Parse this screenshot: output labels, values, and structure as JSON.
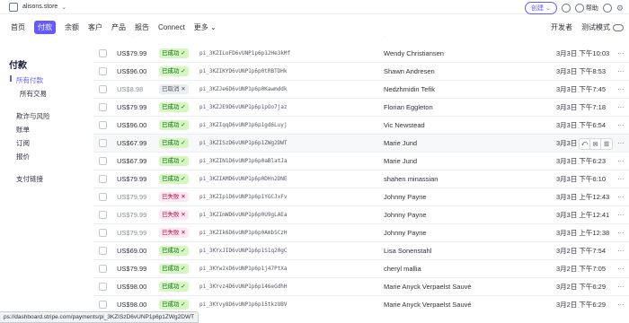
{
  "account": {
    "name": "alisons.store"
  },
  "top_actions": {
    "create_label": "创建",
    "help_label": "帮助"
  },
  "nav": {
    "items": [
      "首页",
      "付款",
      "余额",
      "客户",
      "产品",
      "报告",
      "Connect",
      "更多"
    ],
    "active_index": 1,
    "developers_label": "开发者",
    "test_mode_label": "测试模式"
  },
  "sidebar": {
    "title": "付款",
    "items": [
      "所有付款",
      "所有交易",
      "欺诈与风险",
      "账单",
      "订阅",
      "报价",
      "支付链接"
    ],
    "active_index": 0
  },
  "payments": [
    {
      "amount": "US$79.99",
      "status": "已成功",
      "kind": "ok",
      "id": "pi_3KZILoFD6vUNP1p6p12He3kMf",
      "customer": "Wendy Christiansen",
      "date": "3月3日 下午10:03"
    },
    {
      "amount": "US$96.00",
      "status": "已成功",
      "kind": "ok",
      "id": "pi_3KZIKYD6vUNP1p6p0tRBTDHk",
      "customer": "Shawn Andresen",
      "date": "3月3日 下午8:53"
    },
    {
      "amount": "US$8.98",
      "status": "已取消",
      "kind": "void",
      "id": "pi_3KZJe6D6vUNP1p6p0Kawmddk",
      "customer": "Nedzhmidin Tefik",
      "date": "3月3日 下午7:45"
    },
    {
      "amount": "US$79.99",
      "status": "已成功",
      "kind": "ok",
      "id": "pi_3KZJE9D6vUNP1p6p1pOo7jaz",
      "customer": "Florian Eggleton",
      "date": "3月3日 下午7:18"
    },
    {
      "amount": "US$96.00",
      "status": "已成功",
      "kind": "ok",
      "id": "pi_3KZIqqD6vUNP1p6p1gd6Luyj",
      "customer": "Vic Newstead",
      "date": "3月3日 下午6:54"
    },
    {
      "amount": "US$67.99",
      "status": "已成功",
      "kind": "ok",
      "id": "pi_3KZISzD6vUNP1p6p1ZWg2DWT",
      "customer": "Marie Jund",
      "date": "3月3日 下午"
    },
    {
      "amount": "US$67.99",
      "status": "已成功",
      "kind": "ok",
      "id": "pi_3KZIN1D6vUNP1p6p0aBlatJa",
      "customer": "Marie Jund",
      "date": "3月3日 下午6:23"
    },
    {
      "amount": "US$79.99",
      "status": "已成功",
      "kind": "ok",
      "id": "pi_3KZIAMD6vUNP1p6p0DHn2DNE",
      "customer": "shahen minassian",
      "date": "3月3日 下午6:10"
    },
    {
      "amount": "US$79.99",
      "status": "已失败",
      "kind": "fail",
      "id": "pi_3KZIp1D6vUNP1p6p1YGCJxFv",
      "customer": "Johnny Payne",
      "date": "3月3日 上午12:43"
    },
    {
      "amount": "US$79.99",
      "status": "已失败",
      "kind": "fail",
      "id": "pi_3KZImWD6vUNP1p6p0U9gLAEa",
      "customer": "Johnny Payne",
      "date": "3月3日 上午12:41"
    },
    {
      "amount": "US$79.99",
      "status": "已失败",
      "kind": "fail",
      "id": "pi_3KZIk6D6vUNP1p6p0AmbSCzH",
      "customer": "Johnny Payne",
      "date": "3月3日 上午12:38"
    },
    {
      "amount": "US$69.00",
      "status": "已成功",
      "kind": "ok",
      "id": "pi_3KYxJID6vUNP1p6p1S1q20gC",
      "customer": "Lisa Sonenstahl",
      "date": "3月2日 下午7:54"
    },
    {
      "amount": "US$79.99",
      "status": "已成功",
      "kind": "ok",
      "id": "pi_3KYw2xD6vUNP1p6p1j47PtXa",
      "customer": "cheryl mallia",
      "date": "3月2日 下午7:05"
    },
    {
      "amount": "US$98.00",
      "status": "已成功",
      "kind": "ok",
      "id": "pi_3KYvz4D6vUNP1p6p146eGdhH",
      "customer": "Marie Anyck Verpaelst Sauvé",
      "date": "3月2日 下午6:29"
    },
    {
      "amount": "US$98.00",
      "status": "已成功",
      "kind": "ok",
      "id": "pi_3KYvy8D6vUNP1p6p15tkzUBV",
      "customer": "Marie Anyck Verpaelst Sauvé",
      "date": "3月2日 下午6:29"
    }
  ],
  "status_url": "ps://dashboard.stripe.com/payments/pi_3KZISzD6vUNP1p6p1ZWg2DWT",
  "colors": {
    "accent": "#635bff",
    "success_bg": "#d7f7c2",
    "fail_bg": "#ffe7f2"
  }
}
